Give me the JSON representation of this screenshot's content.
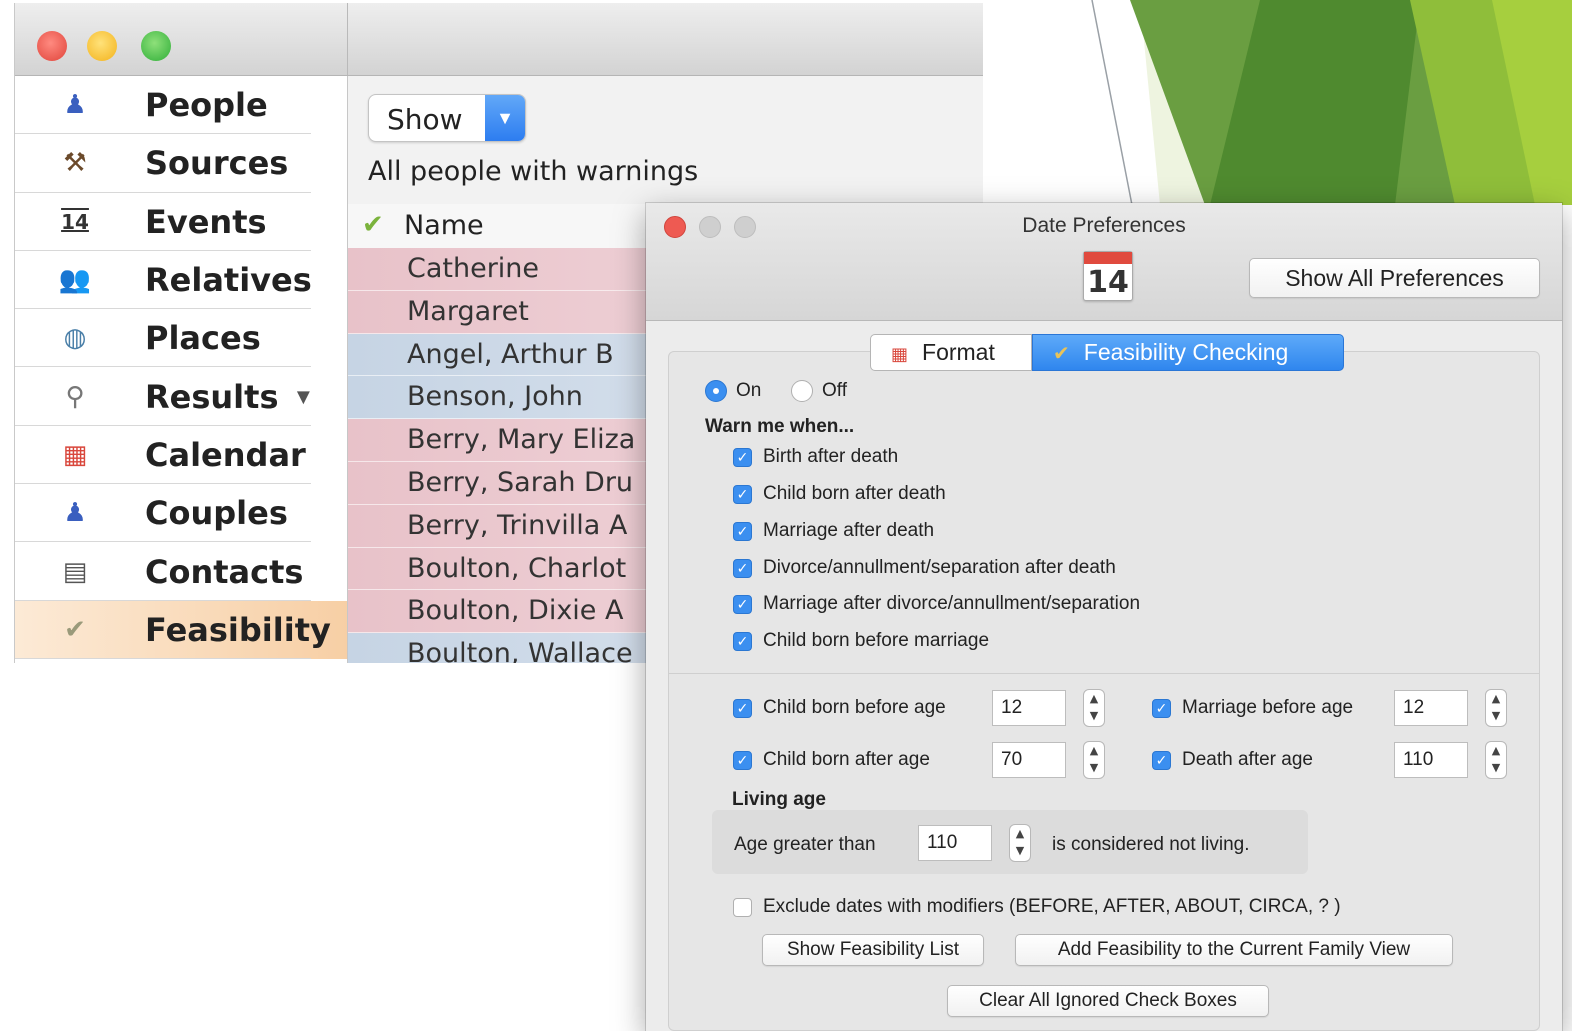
{
  "app": {
    "sidebar": [
      {
        "label": "People",
        "icon": "people-icon",
        "glyph": "♟",
        "color": "#3a5fbf"
      },
      {
        "label": "Sources",
        "icon": "shovel-icon",
        "glyph": "⚒",
        "color": "#6b4a2b"
      },
      {
        "label": "Events",
        "icon": "calendar-14-icon",
        "glyph": "14",
        "color": "#333333"
      },
      {
        "label": "Relatives",
        "icon": "relatives-icon",
        "glyph": "👥",
        "color": "#c08a2b"
      },
      {
        "label": "Places",
        "icon": "globe-icon",
        "glyph": "◍",
        "color": "#4a7fa8"
      },
      {
        "label": "Results",
        "icon": "magnifier-icon",
        "glyph": "⚲",
        "color": "#777777"
      },
      {
        "label": "Calendar",
        "icon": "calendar-icon",
        "glyph": "▦",
        "color": "#d9473c"
      },
      {
        "label": "Couples",
        "icon": "couples-icon",
        "glyph": "♟",
        "color": "#3a5fbf"
      },
      {
        "label": "Contacts",
        "icon": "contacts-icon",
        "glyph": "▤",
        "color": "#555555"
      },
      {
        "label": "Feasibility",
        "icon": "checkmark-icon",
        "glyph": "✔",
        "color": "#9a9a7a"
      }
    ],
    "show_select": "Show",
    "subtitle": "All people with warnings",
    "list_header": "Name",
    "rows": [
      {
        "name": "Catherine",
        "tone": "pink"
      },
      {
        "name": "Margaret",
        "tone": "pink"
      },
      {
        "name": "Angel, Arthur B",
        "tone": "blue"
      },
      {
        "name": "Benson, John",
        "tone": "blue"
      },
      {
        "name": "Berry, Mary Eliza",
        "tone": "pink"
      },
      {
        "name": "Berry, Sarah Dru",
        "tone": "pink"
      },
      {
        "name": "Berry, Trinvilla A",
        "tone": "pink"
      },
      {
        "name": "Boulton, Charlot",
        "tone": "pink"
      },
      {
        "name": "Boulton, Dixie A",
        "tone": "pink"
      },
      {
        "name": "Boulton, Wallace",
        "tone": "blue"
      }
    ]
  },
  "prefs": {
    "title": "Date Preferences",
    "cal_icon_day": "14",
    "show_all": "Show All Preferences",
    "tab_format": "Format",
    "tab_feasibility": "Feasibility Checking",
    "on_label": "On",
    "off_label": "Off",
    "warn_heading": "Warn me when...",
    "warnings": [
      "Birth after death",
      "Child born after death",
      "Marriage after death",
      "Divorce/annullment/separation after death",
      "Marriage after divorce/annullment/separation",
      "Child born before marriage"
    ],
    "child_before_age_label": "Child born before age",
    "child_before_age": "12",
    "marriage_before_age_label": "Marriage before age",
    "marriage_before_age": "12",
    "child_after_age_label": "Child born after age",
    "child_after_age": "70",
    "death_after_age_label": "Death after age",
    "death_after_age": "110",
    "living_heading": "Living age",
    "living_prefix": "Age greater than",
    "living_value": "110",
    "living_suffix": "is considered not living.",
    "exclude_label": "Exclude dates with modifiers (BEFORE, AFTER, ABOUT, CIRCA, ? )",
    "btn_show_list": "Show Feasibility List",
    "btn_add_family": "Add Feasibility to the Current Family View",
    "btn_clear": "Clear All Ignored Check Boxes"
  },
  "colors": {
    "accent_blue": "#3b8ff0",
    "slide_green_dark": "#5f9a38",
    "slide_green_light": "#8fbe3a"
  }
}
